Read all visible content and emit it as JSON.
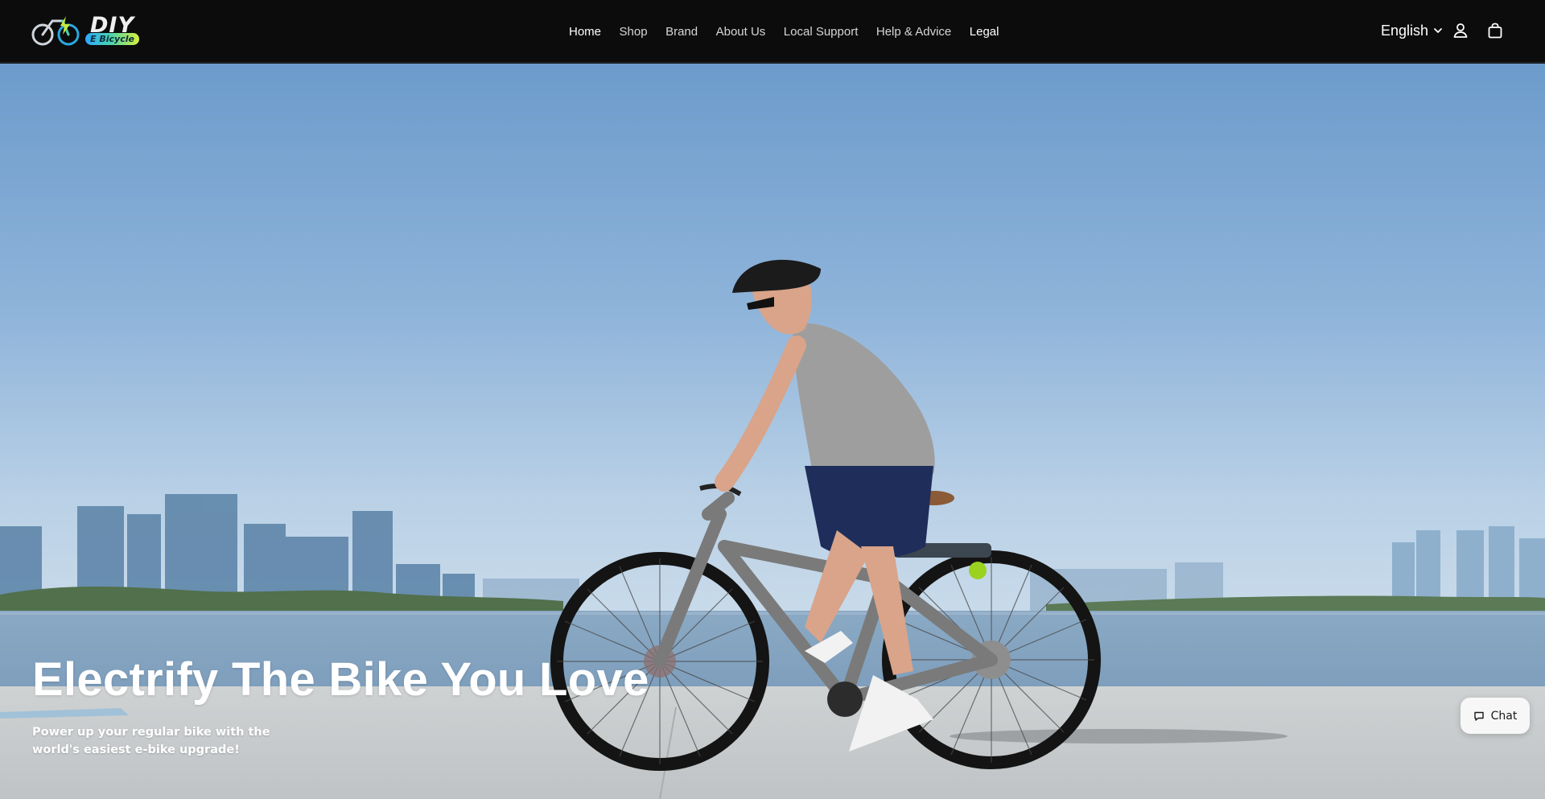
{
  "brand": {
    "logo_text": "DIY",
    "logo_badge": "E Bicycle",
    "logo_icon": "bicycle-logo-icon"
  },
  "nav": {
    "items": [
      {
        "label": "Home"
      },
      {
        "label": "Shop"
      },
      {
        "label": "Brand"
      },
      {
        "label": "About Us"
      },
      {
        "label": "Local Support"
      },
      {
        "label": "Help & Advice"
      },
      {
        "label": "Legal"
      }
    ]
  },
  "header_actions": {
    "language": "English",
    "language_icon": "chevron-down-icon",
    "account_icon": "user-icon",
    "cart_icon": "shopping-bag-icon"
  },
  "hero": {
    "title": "Electrify The Bike You Love",
    "subtitle": "Power up your regular bike with the world's easiest e-bike upgrade!"
  },
  "chat": {
    "label": "Chat",
    "icon": "chat-bubble-icon"
  },
  "colors": {
    "header_bg": "#0c0c0c",
    "sky_top": "#6f9fd0",
    "water": "#7e9fbd",
    "pavement": "#c8cccd",
    "logo_gradient_start": "#2ea7ff",
    "logo_gradient_end": "#d8f03a"
  }
}
